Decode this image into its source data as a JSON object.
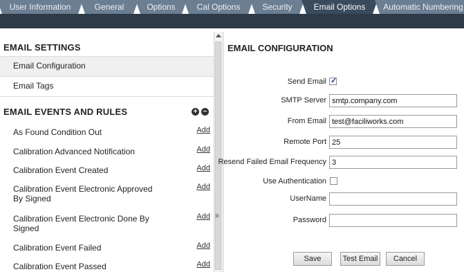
{
  "tabs": [
    {
      "label": "User Information",
      "active": false
    },
    {
      "label": "General",
      "active": false
    },
    {
      "label": "Options",
      "active": false
    },
    {
      "label": "Cal Options",
      "active": false
    },
    {
      "label": "Security",
      "active": false
    },
    {
      "label": "Email Options",
      "active": true
    },
    {
      "label": "Automatic Numbering",
      "active": false
    }
  ],
  "left": {
    "settings_heading": "EMAIL SETTINGS",
    "settings_items": [
      "Email Configuration",
      "Email Tags"
    ],
    "rules_heading": "EMAIL EVENTS AND RULES",
    "add_label": "Add",
    "rules": [
      "As Found Condition Out",
      "Calibration Advanced Notification",
      "Calibration Event Created",
      "Calibration Event Electronic Approved By Signed",
      "Calibration Event Electronic Done By Signed",
      "Calibration Event Failed",
      "Calibration Event Passed"
    ]
  },
  "right": {
    "title": "EMAIL CONFIGURATION",
    "send_email_label": "Send Email",
    "send_email_checked": true,
    "smtp_label": "SMTP Server",
    "smtp_value": "smtp.company.com",
    "from_label": "From Email",
    "from_value": "test@faciliworks.com",
    "port_label": "Remote Port",
    "port_value": "25",
    "resend_label": "Resend Failed Email Frequency",
    "resend_value": "3",
    "auth_label": "Use Authentication",
    "auth_checked": false,
    "username_label": "UserName",
    "username_value": "",
    "password_label": "Password",
    "password_value": "",
    "save_label": "Save",
    "test_label": "Test Email",
    "cancel_label": "Cancel"
  },
  "colors": {
    "tab": "#6b7e92",
    "tab_active": "#3a4b5d",
    "dark_bar": "#2e3a48"
  }
}
